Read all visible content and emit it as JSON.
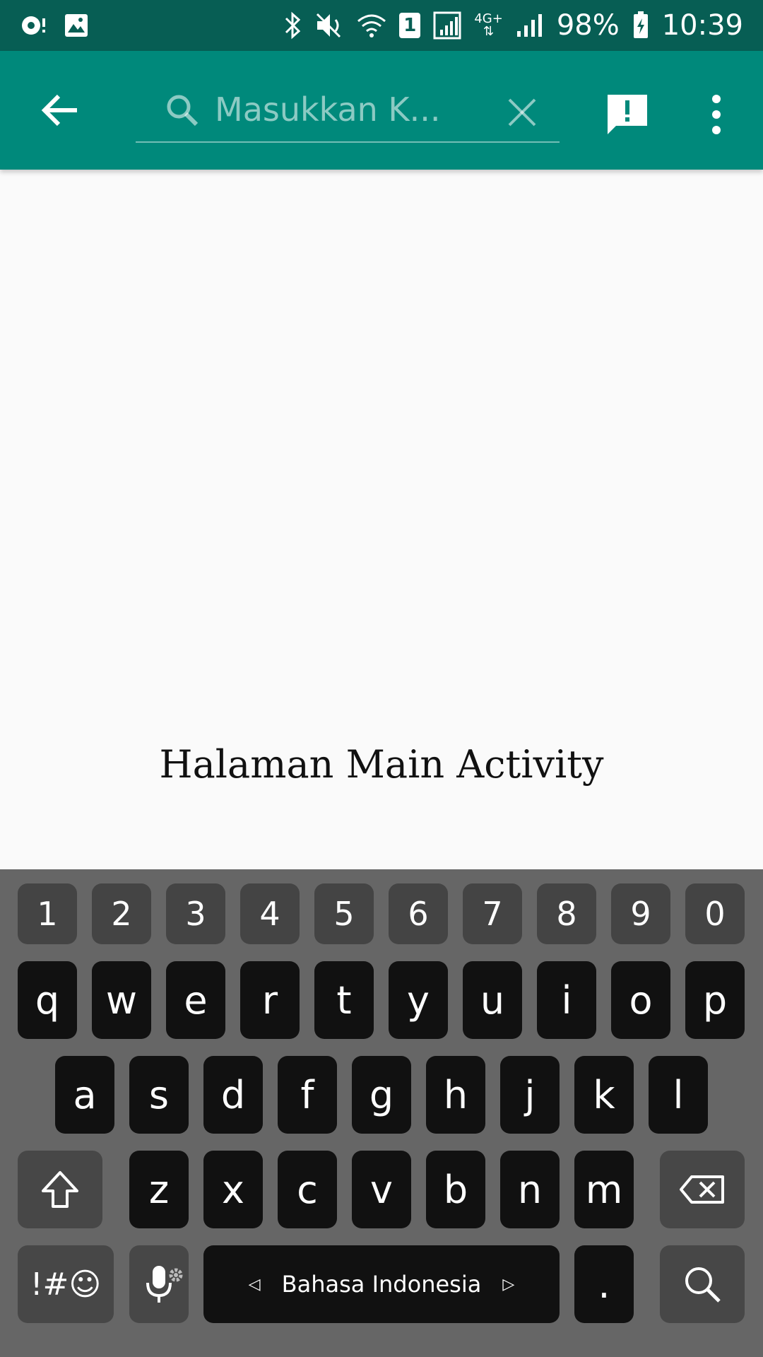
{
  "status_bar": {
    "battery": "98%",
    "time": "10:39",
    "sim": "1",
    "network": "4G+",
    "left_icons": [
      "sync-icon",
      "image-icon"
    ],
    "right_icons": [
      "bluetooth-icon",
      "mute-icon",
      "wifi-icon",
      "sim-signal-icon",
      "signal-icon",
      "battery-charging-icon"
    ]
  },
  "app_bar": {
    "search_placeholder": "Masukkan K...",
    "search_value": "",
    "background": "#00897b",
    "status_background": "#075e54"
  },
  "main": {
    "text": "Halaman Main Activity"
  },
  "keyboard": {
    "number_row": [
      "1",
      "2",
      "3",
      "4",
      "5",
      "6",
      "7",
      "8",
      "9",
      "0"
    ],
    "row1": [
      "q",
      "w",
      "e",
      "r",
      "t",
      "y",
      "u",
      "i",
      "o",
      "p"
    ],
    "row2": [
      "a",
      "s",
      "d",
      "f",
      "g",
      "h",
      "j",
      "k",
      "l"
    ],
    "row3": [
      "z",
      "x",
      "c",
      "v",
      "b",
      "n",
      "m"
    ],
    "symbols_label": "!#☺",
    "space_label": "Bahasa Indonesia",
    "period_label": ".",
    "key_color": "#111111",
    "func_key_color": "#474747",
    "background": "#666666"
  }
}
